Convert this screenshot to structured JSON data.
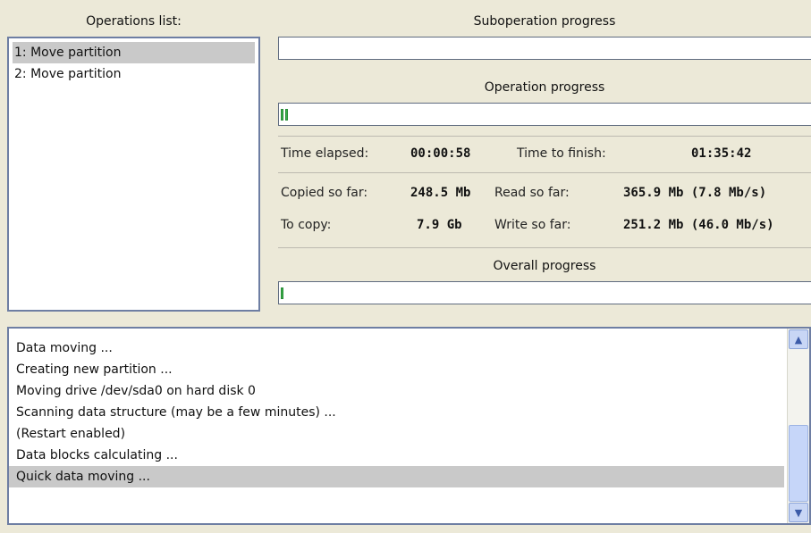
{
  "operations": {
    "header": "Operations list:",
    "items": [
      "1: Move partition",
      "2: Move partition"
    ]
  },
  "suboperation": {
    "header": "Suboperation progress",
    "progress": 0
  },
  "operation": {
    "header": "Operation progress",
    "progress": 0.02
  },
  "overall": {
    "header": "Overall progress",
    "progress": 0.005
  },
  "stats": {
    "time_elapsed_label": "Time elapsed:",
    "time_elapsed": "00:00:58",
    "time_to_finish_label": "Time to finish:",
    "time_to_finish": "01:35:42",
    "copied_label": "Copied so far:",
    "copied": "248.5 Mb",
    "to_copy_label": "To copy:",
    "to_copy": "7.9 Gb",
    "read_label": "Read so far:",
    "read": "365.9 Mb (7.8 Mb/s)",
    "write_label": "Write so far:",
    "write": "251.2 Mb (46.0 Mb/s)"
  },
  "log": {
    "lines": [
      "Data moving ...",
      "Creating new partition ...",
      "Moving drive /dev/sda0 on hard disk 0",
      "Scanning data structure (may be a few minutes) ...",
      "(Restart enabled)",
      "Data blocks calculating ...",
      "Quick data moving ..."
    ]
  },
  "colors": {
    "progress_fill": "#38b24a",
    "selection": "#c9c9c9",
    "border": "#6e7ea3"
  },
  "icons": {
    "scroll_up": "chevron-up-icon",
    "scroll_down": "chevron-down-icon"
  }
}
